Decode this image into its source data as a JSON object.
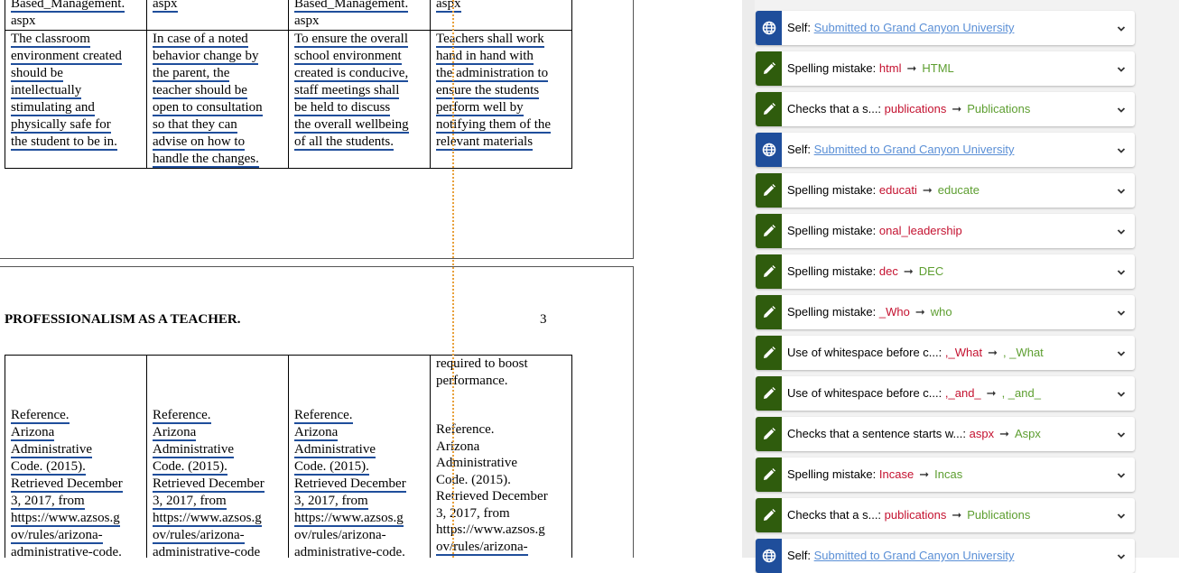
{
  "document": {
    "top_table": {
      "head_rows": [
        [
          "Based_Management.",
          "aspx",
          "Based_Management.",
          "aspx"
        ],
        [
          "aspx",
          "",
          "aspx",
          ""
        ]
      ],
      "body_cells": [
        [
          "The classroom",
          "environment created",
          "should be",
          "intellectually",
          "stimulating and",
          "physically safe for",
          "the student to be in."
        ],
        [
          "In case of a noted",
          "behavior change by",
          "the parent, the",
          "teacher should be",
          "open to consultation",
          "so that they can",
          "advise on how to",
          "handle the changes."
        ],
        [
          "To ensure the overall",
          "school environment",
          "created is conducive,",
          "staff meetings shall",
          "be held to discuss",
          "the overall wellbeing",
          "of all the students."
        ],
        [
          "Teachers shall work",
          "hand in hand with",
          "the administration to",
          "ensure the students",
          "perform well by",
          "notifying them of the",
          "relevant materials"
        ]
      ]
    },
    "running_header": "PROFESSIONALISM AS A TEACHER.",
    "page_number": "3",
    "bottom_table": {
      "col4_top": [
        "required to boost",
        "performance."
      ],
      "ref_cells": [
        [
          "Reference.",
          "Arizona",
          "Administrative",
          "Code. (2015).",
          "Retrieved December",
          "3, 2017, from",
          "https://www.azsos.g",
          "ov/rules/arizona-",
          "administrative-code."
        ],
        [
          "Reference.",
          "Arizona",
          "Administrative",
          "Code. (2015).",
          "Retrieved December",
          "3, 2017, from",
          "https://www.azsos.g",
          "ov/rules/arizona-",
          "administrative-code"
        ],
        [
          "Reference.",
          "Arizona",
          "Administrative",
          "Code. (2015).",
          "Retrieved December",
          "3, 2017, from",
          "https://www.azsos.g",
          "ov/rules/arizona-",
          "administrative-code."
        ],
        [
          "Reference.",
          "Arizona",
          "Administrative",
          "Code. (2015).",
          "Retrieved December",
          "3, 2017, from",
          "https://www.azsos.g",
          "ov/rules/arizona-",
          ""
        ]
      ]
    }
  },
  "suggestions": [
    {
      "kind": "self",
      "icon": "globe-icon",
      "label": "Self:",
      "link": "Submitted to Grand Canyon University",
      "bad": "",
      "good": ""
    },
    {
      "kind": "fix",
      "icon": "pencil-icon",
      "label": "Spelling mistake:",
      "link": "",
      "bad": "html",
      "good": "HTML"
    },
    {
      "kind": "fix",
      "icon": "pencil-icon",
      "label": "Checks that a s...:",
      "link": "",
      "bad": "publications",
      "good": "Publications"
    },
    {
      "kind": "self",
      "icon": "globe-icon",
      "label": "Self:",
      "link": "Submitted to Grand Canyon University",
      "bad": "",
      "good": ""
    },
    {
      "kind": "fix",
      "icon": "pencil-icon",
      "label": "Spelling mistake:",
      "link": "",
      "bad": "educati",
      "good": "educate"
    },
    {
      "kind": "fix",
      "icon": "pencil-icon",
      "label": "Spelling mistake:",
      "link": "",
      "bad": "onal_leadership",
      "good": ""
    },
    {
      "kind": "fix",
      "icon": "pencil-icon",
      "label": "Spelling mistake:",
      "link": "",
      "bad": "dec",
      "good": "DEC"
    },
    {
      "kind": "fix",
      "icon": "pencil-icon",
      "label": "Spelling mistake:",
      "link": "",
      "bad": "_Who",
      "good": "who"
    },
    {
      "kind": "fix",
      "icon": "pencil-icon",
      "label": "Use of whitespace before c...:",
      "link": "",
      "bad": ",_What",
      "good": ", _What"
    },
    {
      "kind": "fix",
      "icon": "pencil-icon",
      "label": "Use of whitespace before c...:",
      "link": "",
      "bad": ",_and_",
      "good": ", _and_"
    },
    {
      "kind": "fix",
      "icon": "pencil-icon",
      "label": "Checks that a sentence starts w...:",
      "link": "",
      "bad": "aspx",
      "good": "Aspx"
    },
    {
      "kind": "fix",
      "icon": "pencil-icon",
      "label": "Spelling mistake:",
      "link": "",
      "bad": "Incase",
      "good": "Incas"
    },
    {
      "kind": "fix",
      "icon": "pencil-icon",
      "label": "Checks that a s...:",
      "link": "",
      "bad": "publications",
      "good": "Publications"
    },
    {
      "kind": "self",
      "icon": "globe-icon",
      "label": "Self:",
      "link": "Submitted to Grand Canyon University",
      "bad": "",
      "good": ""
    }
  ],
  "colors": {
    "pencil_bg": "#2f5c0d",
    "globe_bg": "#1f4e9b",
    "error": "#c41230",
    "fix": "#5d9e30",
    "link": "#5a8fd6",
    "underline": "#1f4e9b"
  }
}
